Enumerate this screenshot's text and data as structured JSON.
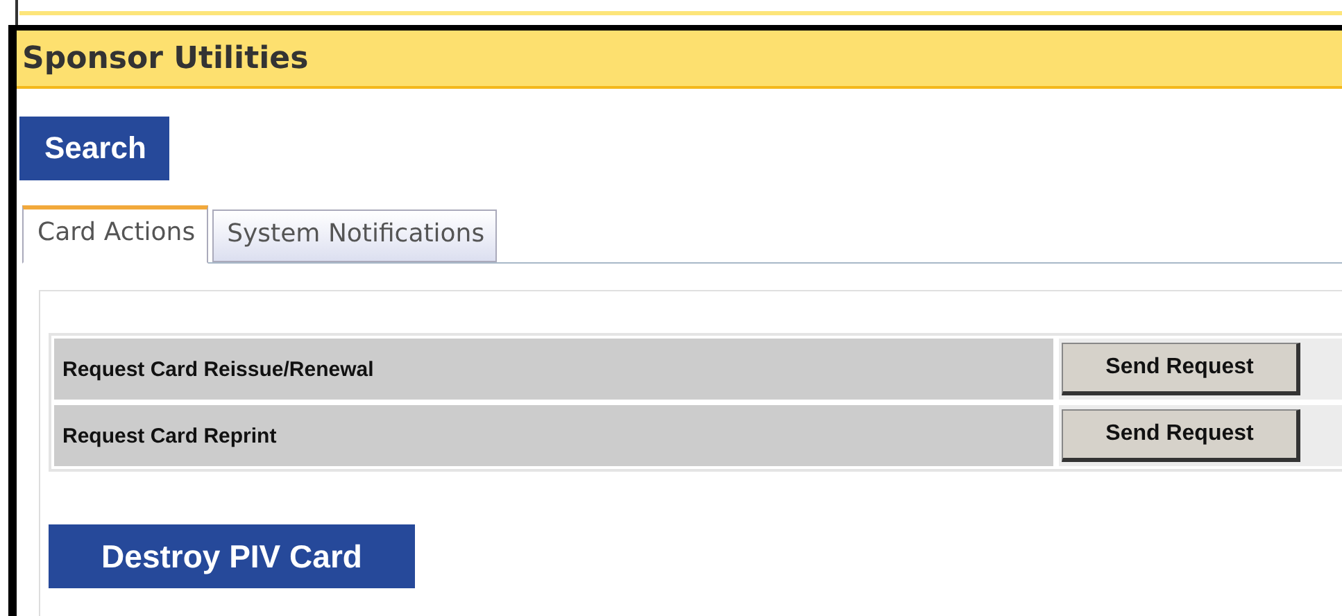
{
  "header": {
    "title": "Sponsor Utilities"
  },
  "search_button": "Search",
  "tabs": [
    {
      "label": "Card Actions",
      "selected": true
    },
    {
      "label": "System Notifications",
      "selected": false
    }
  ],
  "actions": [
    {
      "label": "Request Card Reissue/Renewal",
      "button": "Send Request"
    },
    {
      "label": "Request Card Reprint",
      "button": "Send Request"
    }
  ],
  "destroy_button": "Destroy PIV Card"
}
